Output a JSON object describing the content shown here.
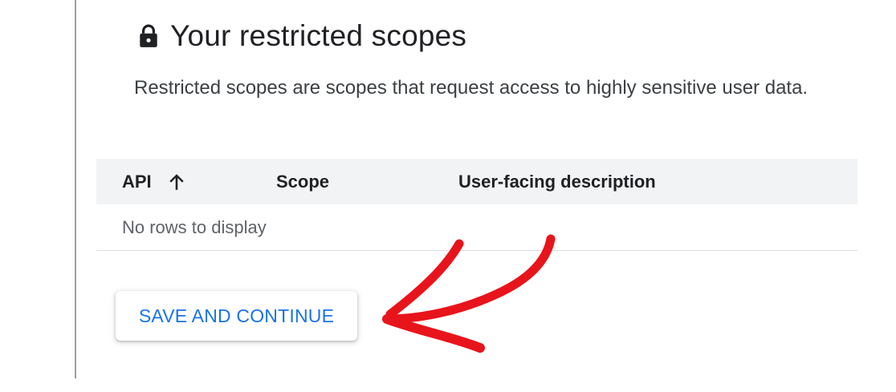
{
  "section": {
    "icon": "lock-icon",
    "title": "Your restricted scopes",
    "description": "Restricted scopes are scopes that request access to highly sensitive user data."
  },
  "table": {
    "columns": [
      {
        "label": "API",
        "sort": "ascending",
        "sort_icon": "arrow-upward-icon"
      },
      {
        "label": "Scope"
      },
      {
        "label": "User-facing description"
      }
    ],
    "empty_message": "No rows to display"
  },
  "actions": {
    "save_label": "SAVE AND CONTINUE"
  },
  "annotation": {
    "shape": "hand-drawn-arrow",
    "points_to": "save-and-continue-button",
    "color": "#e8141b"
  },
  "colors": {
    "accent": "#1a73e8",
    "header_bg": "#f1f3f4",
    "divider": "#dadce0"
  }
}
